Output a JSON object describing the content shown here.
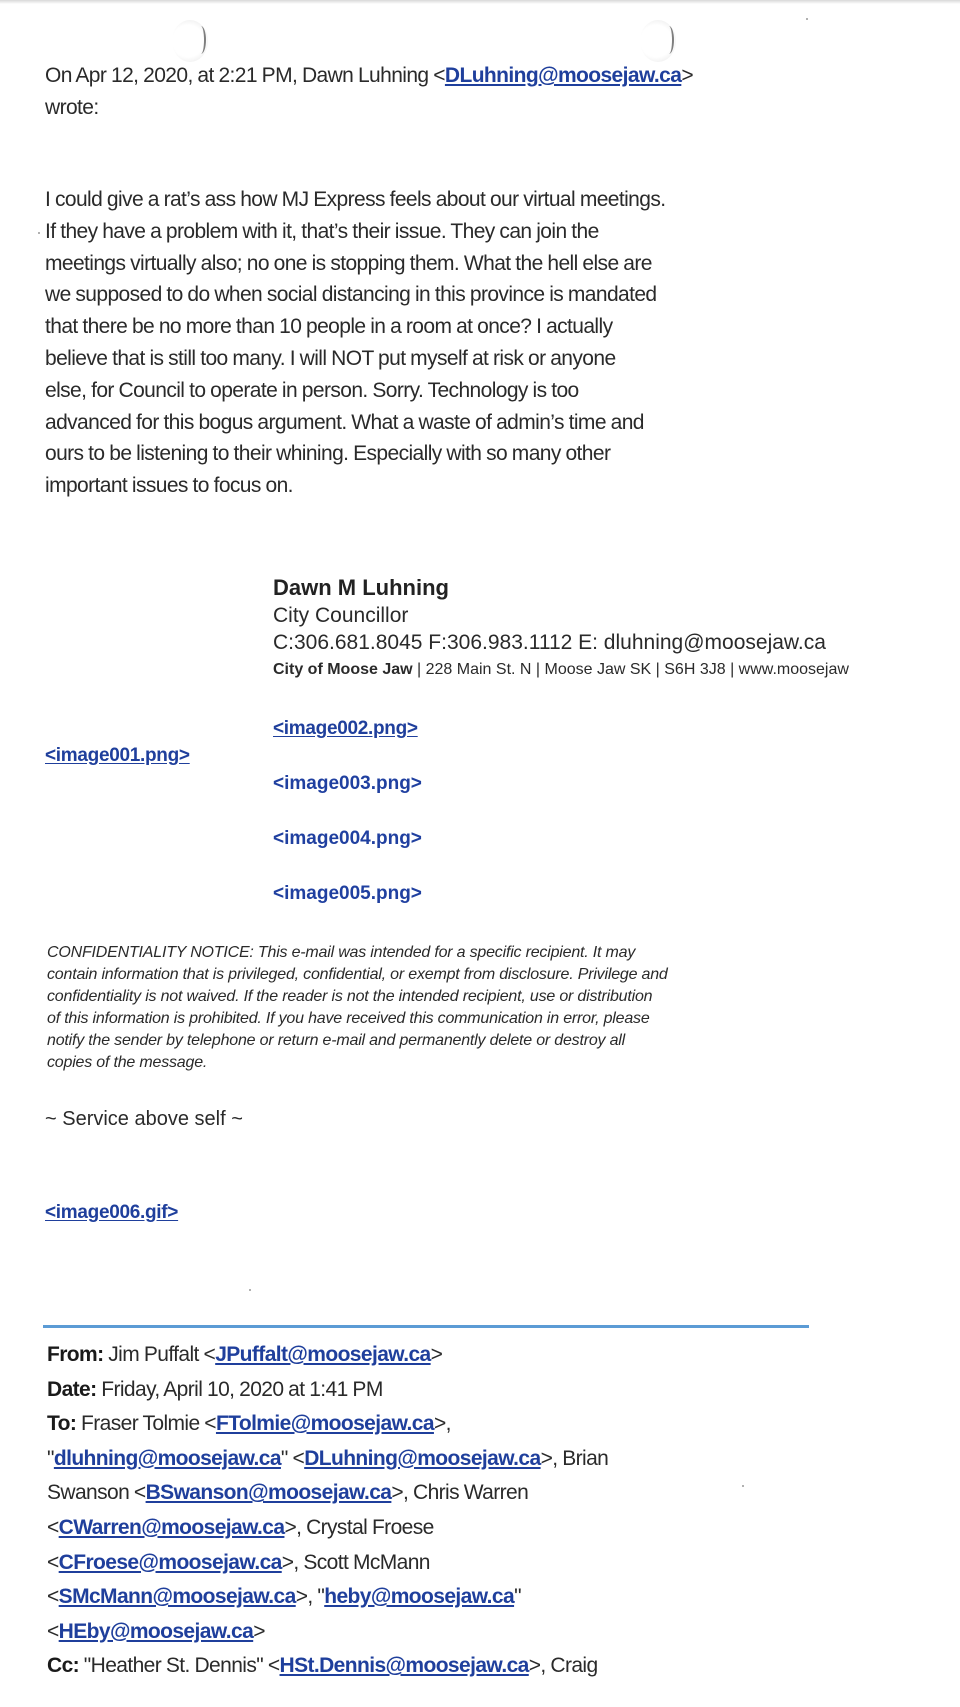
{
  "reply_header": {
    "prefix": "On Apr 12, 2020, at 2:21 PM, Dawn Luhning <",
    "email": "DLuhning@moosejaw.ca",
    "suffix": ">",
    "wrote": "wrote:"
  },
  "message_body": [
    "I could give a rat’s ass how MJ Express feels about our virtual meetings.",
    "If they have a problem with it, that’s their issue. They can join the",
    "meetings virtually also; no one is stopping them. What the hell else are",
    "we supposed to do when social distancing in this province is mandated",
    "that there be no more than 10 people in a room at once? I actually",
    "believe that is still too many. I will NOT put myself at risk or anyone",
    "else, for Council to operate in person. Sorry. Technology is too",
    "advanced for this bogus argument. What a waste of admin’s time and",
    "ours to be listening to their whining. Especially with so many other",
    "important issues to focus on."
  ],
  "signature": {
    "name": "Dawn M Luhning",
    "title": "City Councillor",
    "contact": "C:306.681.8045 F:306.983.1112 E: dluhning@moosejaw.ca",
    "org": "City of Moose Jaw",
    "address": "  | 228 Main St. N | Moose Jaw SK | S6H 3J8 | www.moosejaw"
  },
  "attachments": {
    "image001": "<image001.png>",
    "image002": "<image002.png>",
    "image003": "<image003.png>",
    "image004": "<image004.png>",
    "image005": "<image005.png>",
    "image006": "<image006.gif>"
  },
  "confidentiality_notice": [
    "CONFIDENTIALITY NOTICE:  This e-mail was intended for a specific recipient.  It may",
    "contain information that is privileged, confidential, or exempt from disclosure.  Privilege and",
    "confidentiality is not waived.  If the reader is not the intended recipient, use or distribution",
    "of this information is prohibited.  If you have received this communication in error, please",
    "notify the sender by telephone or return e-mail and permanently delete or destroy all",
    "copies of the message."
  ],
  "motto": "~ Service above self ~",
  "original_message": {
    "from_label": "From:",
    "from_name": " Jim Puffalt <",
    "from_email": "JPuffalt@moosejaw.ca",
    "date_label": "Date:",
    "date_value": " Friday, April 10, 2020 at 1:41 PM",
    "to_label": "To:",
    "to_recipients": [
      {
        "pre": " Fraser Tolmie <",
        "email": "FTolmie@moosejaw.ca",
        "post": ">,"
      },
      {
        "pre": "\"",
        "email": "dluhning@moosejaw.ca",
        "post": "\" <"
      },
      {
        "pre": "",
        "email": "DLuhning@moosejaw.ca",
        "post": ">, Brian"
      },
      {
        "pre": "Swanson <",
        "email": "BSwanson@moosejaw.ca",
        "post": ">, Chris Warren"
      },
      {
        "pre": "<",
        "email": "CWarren@moosejaw.ca",
        "post": ">, Crystal Froese"
      },
      {
        "pre": "<",
        "email": "CFroese@moosejaw.ca",
        "post": ">, Scott McMann"
      },
      {
        "pre": "<",
        "email": "SMcMann@moosejaw.ca",
        "post": ">, \""
      },
      {
        "pre": "",
        "email": "heby@moosejaw.ca",
        "post": "\""
      },
      {
        "pre": "<",
        "email": "HEby@moosejaw.ca",
        "post": ">"
      }
    ],
    "cc_label": "Cc:",
    "cc_pre": " \"Heather St. Dennis\" <",
    "cc_email": "HSt.Dennis@moosejaw.ca",
    "cc_post": ">, Craig"
  },
  "colors": {
    "link": "#1f3f9c",
    "separator": "#5b9bd5",
    "text": "#2a2a2a"
  }
}
